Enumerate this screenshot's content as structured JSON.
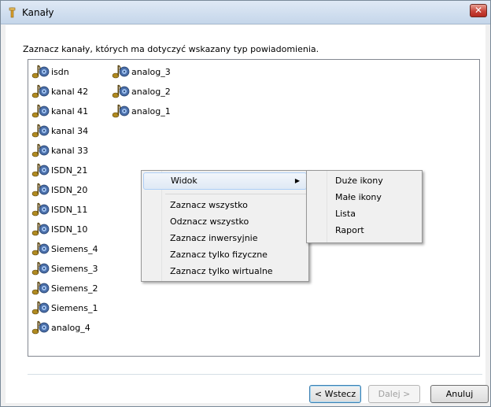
{
  "window": {
    "title": "Kanały",
    "close_label": "✕"
  },
  "instruction": "Zaznacz kanały, których ma dotyczyć wskazany typ powiadomienia.",
  "channels_col1": [
    "isdn",
    "kanal 42",
    "kanal 41",
    "kanal 34",
    "kanal 33",
    "ISDN_21",
    "ISDN_20",
    "ISDN_11",
    "ISDN_10",
    "Siemens_4",
    "Siemens_3",
    "Siemens_2",
    "Siemens_1",
    "analog_4"
  ],
  "channels_col2": [
    "analog_3",
    "analog_2",
    "analog_1"
  ],
  "context_menu": {
    "view_label": "Widok",
    "items": [
      "Zaznacz wszystko",
      "Odznacz wszystko",
      "Zaznacz inwersyjnie",
      "Zaznacz tylko fizyczne",
      "Zaznacz tylko wirtualne"
    ]
  },
  "submenu": {
    "items": [
      "Duże ikony",
      "Małe ikony",
      "Lista",
      "Raport"
    ]
  },
  "buttons": {
    "back": "< Wstecz",
    "next": "Dalej >",
    "cancel": "Anuluj"
  },
  "colors": {
    "title_bar": "#c5d6ea",
    "close_button": "#c7443a",
    "menu_highlight": "#dfe9f5"
  }
}
